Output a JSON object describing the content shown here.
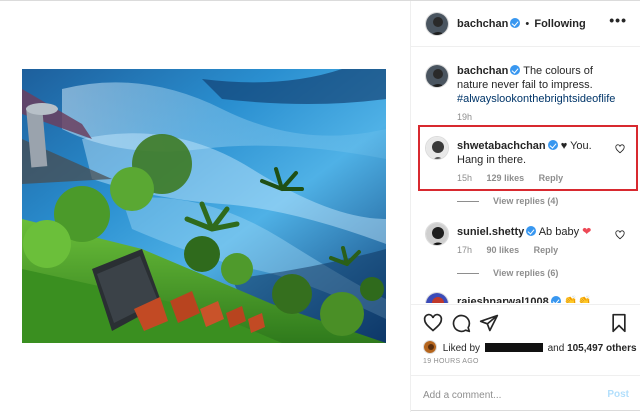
{
  "header": {
    "username": "bachchan",
    "separator": "•",
    "follow_status": "Following",
    "more_icon": "more-horizontal-icon"
  },
  "caption": {
    "username": "bachchan",
    "text": "The colours of nature never fail to impress.",
    "hashtag": "#alwayslookonthebrightsideoflife",
    "time": "19h"
  },
  "comments": [
    {
      "username": "shwetabachchan",
      "text": "You. Hang in there.",
      "emoji": "♥",
      "time": "15h",
      "likes": "129 likes",
      "reply": "Reply",
      "view_replies": "View replies (4)"
    },
    {
      "username": "suniel.shetty",
      "text": "Ab baby",
      "emoji": "❤",
      "time": "17h",
      "likes": "90 likes",
      "reply": "Reply",
      "view_replies": "View replies (6)"
    },
    {
      "username": "rajeshnarwal1008",
      "text": "👏👏"
    }
  ],
  "likes": {
    "prefix": "Liked by",
    "suffix": "and",
    "count": "105,497 others"
  },
  "timestamp": "19 HOURS AGO",
  "add_comment": {
    "placeholder": "Add a comment...",
    "post_label": "Post"
  },
  "colors": {
    "highlight": "#d8292f",
    "verified": "#3897f0",
    "hashtag": "#003569",
    "heart_red": "#ed4956"
  }
}
